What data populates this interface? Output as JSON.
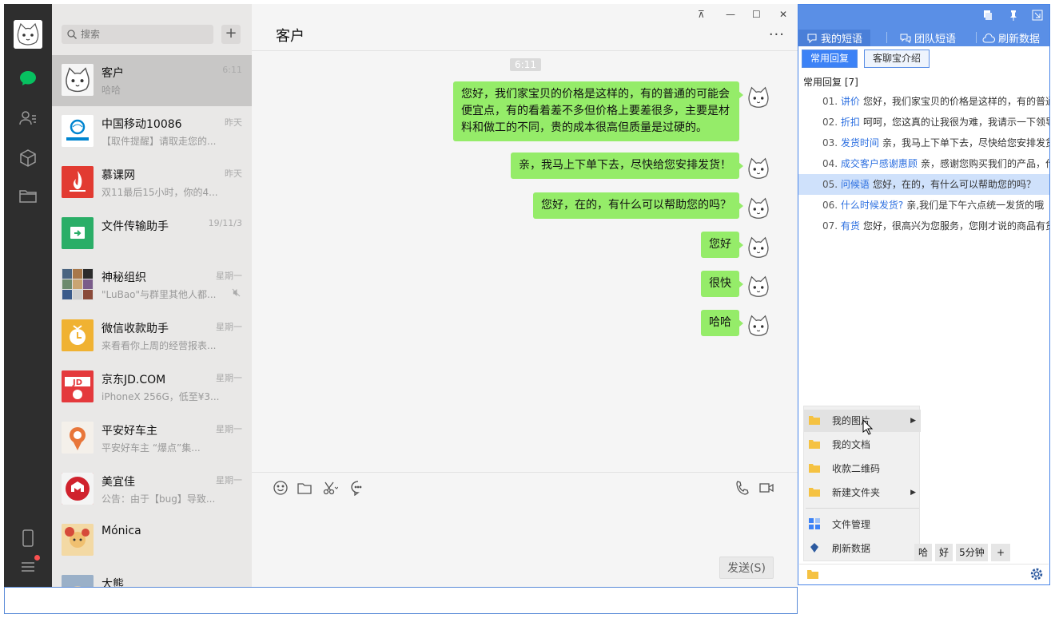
{
  "nav": {
    "icons": [
      "chat-icon",
      "contacts-icon",
      "favorites-icon",
      "folder-icon",
      "phone-icon",
      "menu-icon"
    ],
    "accent": "#07c160"
  },
  "search": {
    "placeholder": "搜索",
    "add_label": "+"
  },
  "chats": [
    {
      "name": "客户",
      "preview": "哈哈",
      "time": "6:11",
      "active": true,
      "avatar": "cat",
      "color": "#ffffff"
    },
    {
      "name": "中国移动10086",
      "preview": "【取件提醒】请取走您的...",
      "time": "昨天",
      "avatar": "mobile",
      "color": "#ffffff"
    },
    {
      "name": "慕课网",
      "preview": "双11最后15小时，你的4...",
      "time": "昨天",
      "avatar": "imooc",
      "color": "#e23b32"
    },
    {
      "name": "文件传输助手",
      "preview": "",
      "time": "19/11/3",
      "avatar": "file",
      "color": "#2aae67"
    },
    {
      "name": "神秘组织",
      "preview": "\"LuBao\"与群里其他人都...",
      "time": "星期一",
      "avatar": "group",
      "color": "#8fa4b8",
      "muted": true
    },
    {
      "name": "微信收款助手",
      "preview": "来看看你上周的经营报表...",
      "time": "星期一",
      "avatar": "pay",
      "color": "#f0b232"
    },
    {
      "name": "京东JD.COM",
      "preview": "iPhoneX 256G，低至¥3...",
      "time": "星期一",
      "avatar": "jd",
      "color": "#e4393c"
    },
    {
      "name": "平安好车主",
      "preview": "平安好车主 “爆点”集...",
      "time": "星期一",
      "avatar": "pingan",
      "color": "#f4f0ea"
    },
    {
      "name": "美宜佳",
      "preview": "公告：由于【bug】导致...",
      "time": "星期一",
      "avatar": "meiyijia",
      "color": "#d0222d"
    },
    {
      "name": "Mónica",
      "preview": "",
      "time": "",
      "avatar": "monica",
      "color": "#f3d9a4"
    },
    {
      "name": "大熊",
      "preview": "",
      "time": "",
      "avatar": "bear",
      "color": "#9ab0c8"
    }
  ],
  "chat": {
    "title": "客户",
    "window_controls": [
      "pin",
      "minimize",
      "maximize",
      "close"
    ],
    "time_tag": "6:11",
    "messages": [
      "您好，我们家宝贝的价格是这样的，有的普通的可能会便宜点，有的看着差不多但价格上要差很多，主要是材料和做工的不同，贵的成本很高但质量是过硬的。",
      "亲，我马上下单下去，尽快给您安排发货！",
      "您好，在的，有什么可以帮助您的吗？",
      "您好",
      "很快",
      "哈哈"
    ],
    "bubble_color": "#95ec69",
    "send_label": "发送(S)"
  },
  "panel": {
    "tabs": [
      "我的短语",
      "团队短语",
      "刷新数据"
    ],
    "subtabs": [
      "常用回复",
      "客聊宝介绍"
    ],
    "group_title": "常用回复 [7]",
    "replies": [
      {
        "num": "01.",
        "key": "讲价",
        "text": "您好，我们家宝贝的价格是这样的，有的普通"
      },
      {
        "num": "02.",
        "key": "折扣",
        "text": "呵呵，您这真的让我很为难，我请示一下领导"
      },
      {
        "num": "03.",
        "key": "发货时间",
        "text": "亲，我马上下单下去，尽快给您安排发货"
      },
      {
        "num": "04.",
        "key": "成交客户感谢惠顾",
        "text": "亲，感谢您购买我们的产品，作"
      },
      {
        "num": "05.",
        "key": "问候语",
        "text": "您好，在的，有什么可以帮助您的吗？",
        "selected": true
      },
      {
        "num": "06.",
        "key": "什么时候发货?",
        "text": "亲,我们是下午六点统一发货的哦"
      },
      {
        "num": "07.",
        "key": "有货",
        "text": "您好，很高兴为您服务，您刚才说的商品有货"
      }
    ],
    "context_menu": [
      {
        "label": "我的图片",
        "submenu": true,
        "hover": true
      },
      {
        "label": "我的文档",
        "submenu": false
      },
      {
        "label": "收款二维码",
        "submenu": false
      },
      {
        "label": "新建文件夹",
        "submenu": true
      },
      {
        "label": "文件管理",
        "submenu": false
      },
      {
        "label": "刷新数据",
        "submenu": false
      }
    ],
    "quick_chips": [
      "哈",
      "好",
      "5分钟",
      "+"
    ],
    "header_color": "#5a8fe6"
  }
}
